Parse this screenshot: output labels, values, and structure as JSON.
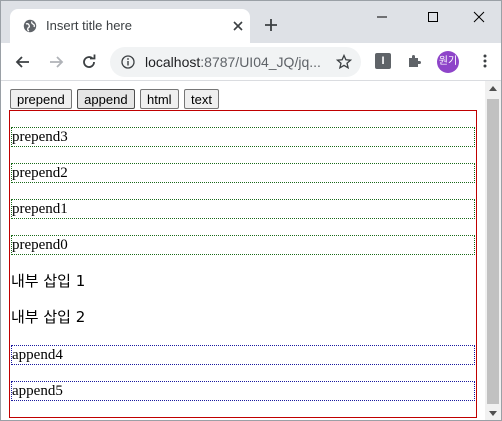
{
  "browser": {
    "tab_title": "Insert title here",
    "url_host": "localhost",
    "url_path": ":8787/UI04_JQ/jq...",
    "profile_label": "원기"
  },
  "page": {
    "buttons": [
      {
        "label": "prepend"
      },
      {
        "label": "append"
      },
      {
        "label": "html"
      },
      {
        "label": "text"
      }
    ],
    "items": [
      {
        "text": "prepend3"
      },
      {
        "text": "prepend2"
      },
      {
        "text": "prepend1"
      },
      {
        "text": "prepend0"
      },
      {
        "text": "내부 삽입 1"
      },
      {
        "text": "내부 삽입 2"
      },
      {
        "text": "append4"
      },
      {
        "text": "append5"
      }
    ]
  },
  "colors": {
    "prepend_border": "#1a6b1a",
    "append_border": "#1a1aa0",
    "container_border": "#c00000",
    "avatar": "#8e44c9"
  }
}
